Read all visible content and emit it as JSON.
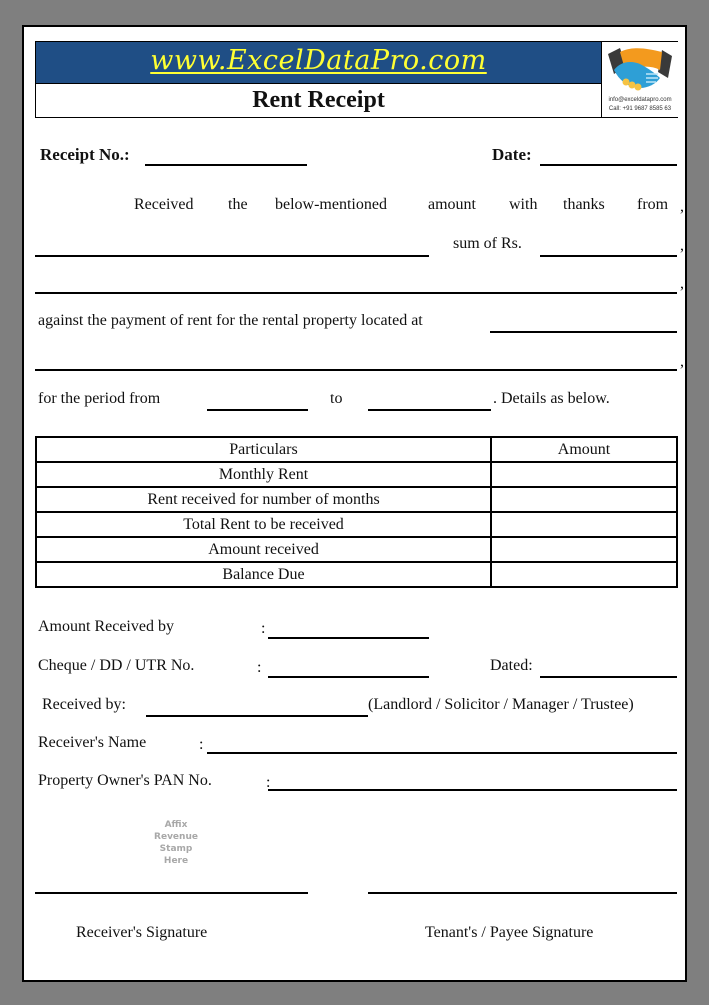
{
  "header": {
    "site_name": "www.ExcelDataPro.com",
    "title": "Rent Receipt",
    "logo_icon": "handshake-icon",
    "contact_email": "info@exceldatapro.com",
    "contact_phone": "Call: +91 9687 8585 63"
  },
  "fields": {
    "receipt_no_label": "Receipt No.:",
    "date_label": "Date:"
  },
  "body_text": {
    "line1_words": [
      "Received",
      "the",
      "below-mentioned",
      "amount",
      "with",
      "thanks",
      "from"
    ],
    "comma": ",",
    "sum_label": "sum of Rs.",
    "property_text": "against the payment of rent for the rental property located at",
    "period_from": "for the period from",
    "period_to": "to",
    "details": ". Details as below."
  },
  "table": {
    "headers": [
      "Particulars",
      "Amount"
    ],
    "rows": [
      {
        "particular": "Monthly Rent",
        "amount": ""
      },
      {
        "particular": "Rent received for number of months",
        "amount": ""
      },
      {
        "particular": "Total Rent to be received",
        "amount": ""
      },
      {
        "particular": "Amount received",
        "amount": ""
      },
      {
        "particular": "Balance Due",
        "amount": ""
      }
    ]
  },
  "payment": {
    "amount_received_by_label": "Amount Received by",
    "cheque_label": "Cheque / DD / UTR No.",
    "dated_label": "Dated:",
    "received_by_label": "Received by:",
    "received_by_roles": "(Landlord / Solicitor / Manager / Trustee)",
    "receiver_name_label": "Receiver's Name",
    "pan_label": "Property Owner's PAN No.",
    "colon": ":"
  },
  "stamp": {
    "lines": [
      "Affix",
      "Revenue",
      "Stamp",
      "Here"
    ]
  },
  "signatures": {
    "receiver": "Receiver's Signature",
    "tenant": "Tenant's / Payee Signature"
  }
}
